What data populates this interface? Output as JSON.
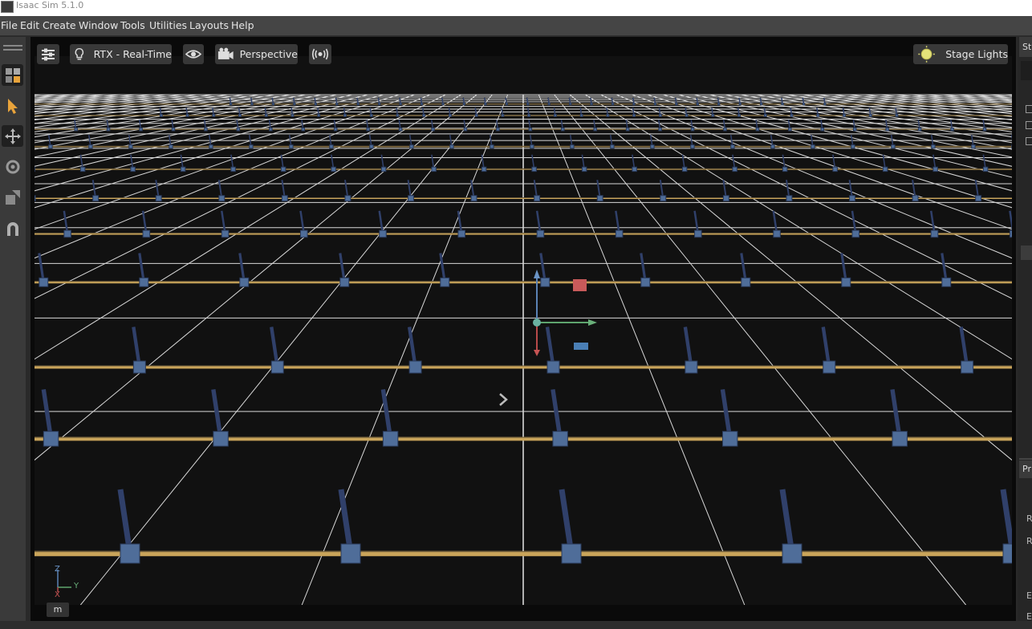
{
  "app": {
    "title": "Isaac Sim 5.1.0"
  },
  "menu": [
    "File",
    "Edit",
    "Create",
    "Window",
    "Tools",
    "Utilities",
    "Layouts",
    "Help"
  ],
  "viewport": {
    "renderer_label": "RTX - Real-Time",
    "camera_label": "Perspective",
    "lights_label": "Stage Lights",
    "unit_label": "m",
    "axis": {
      "z": "Z",
      "y": "Y",
      "x": "X"
    }
  },
  "tools": [
    "create-icon",
    "select-icon",
    "move-icon",
    "rotate-icon",
    "scale-icon",
    "snap-icon"
  ],
  "right_panel": {
    "tabs": [
      "St",
      "Pr"
    ],
    "labels": [
      "R",
      "R",
      "E",
      "E"
    ]
  },
  "colors": {
    "accent": "#e8a33b",
    "grid_line": "#d8d8d8",
    "road": "#c9a45a",
    "background": "#111111"
  }
}
